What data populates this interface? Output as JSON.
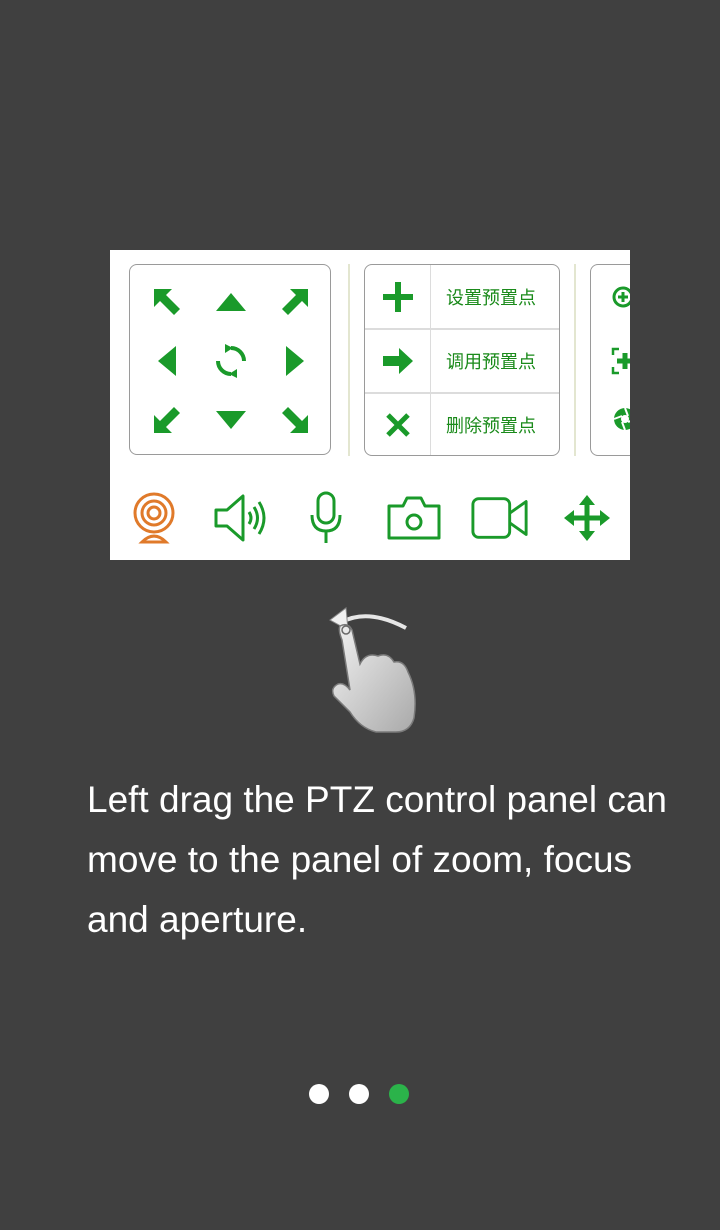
{
  "preset_panel": {
    "set_label": "设置预置点",
    "call_label": "调用预置点",
    "delete_label": "删除预置点"
  },
  "toolbar": {
    "icons": [
      "webcam-icon",
      "speaker-icon",
      "microphone-icon",
      "camera-icon",
      "video-camera-icon",
      "move-arrows-icon"
    ]
  },
  "instruction": "Left drag the PTZ control panel can move to the panel of zoom, focus and aperture.",
  "pager": {
    "total": 3,
    "active_index": 3
  },
  "colors": {
    "accent_green": "#1a9a2a",
    "orange": "#e07a2a",
    "background": "#404040",
    "dot_active": "#2bb34a"
  }
}
